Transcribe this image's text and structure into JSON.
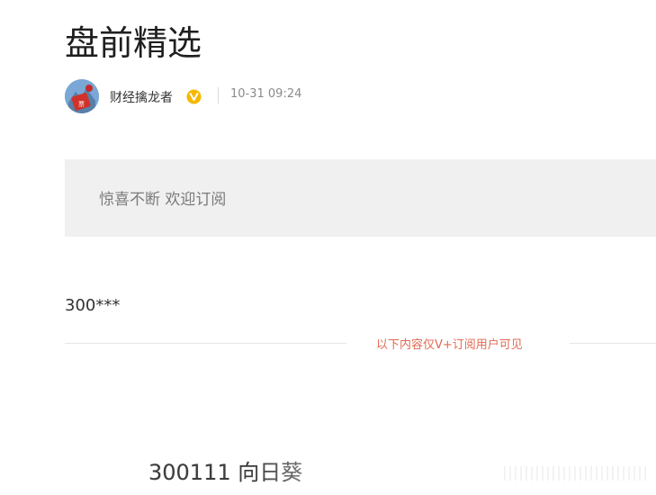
{
  "article": {
    "title": "盘前精选"
  },
  "author": {
    "name": "财经擒龙者",
    "verified_icon": "vip-badge-icon",
    "avatar_icon": "avatar",
    "time": "10-31 09:24"
  },
  "banner": {
    "text": "惊喜不断 欢迎订阅"
  },
  "content": {
    "stock_code": "300***",
    "locked_notice": "以下内容仅V+订阅用户可见",
    "preview_line": "300111 向日葵"
  },
  "colors": {
    "locked_notice": "#e06a52",
    "verified_badge": "#f5b800",
    "banner_bg": "#f0f0f0"
  }
}
